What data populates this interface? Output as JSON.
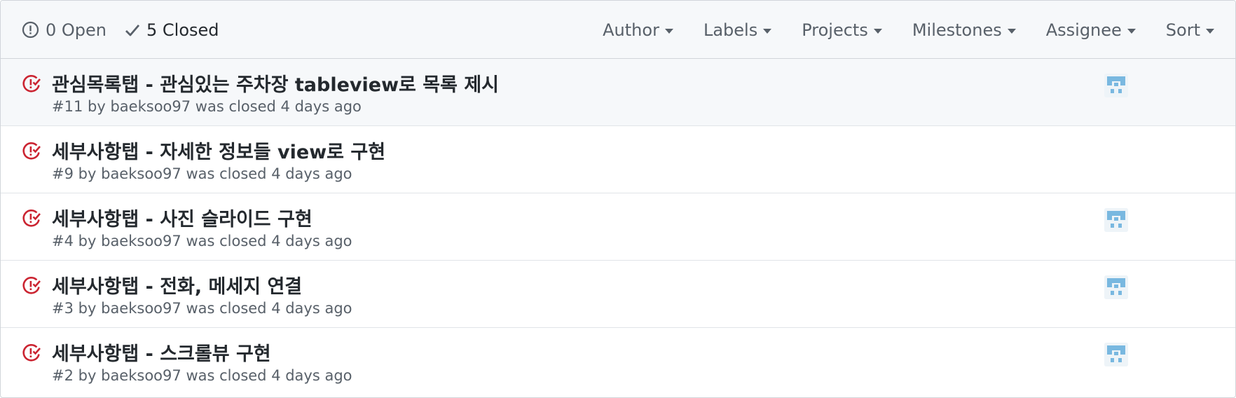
{
  "header": {
    "open": {
      "count_label": "0 Open",
      "icon": "issue-opened-icon"
    },
    "closed": {
      "count_label": "5 Closed",
      "icon": "check-icon"
    },
    "filters": [
      {
        "label": "Author"
      },
      {
        "label": "Labels"
      },
      {
        "label": "Projects"
      },
      {
        "label": "Milestones"
      },
      {
        "label": "Assignee"
      },
      {
        "label": "Sort"
      }
    ]
  },
  "issues": [
    {
      "title": "관심목록탭 - 관심있는 주차장 tableview로 목록 제시",
      "number": "#11",
      "by": "by",
      "author": "baeksoo97",
      "status": "was closed 4 days ago",
      "has_assignee": true
    },
    {
      "title": "세부사항탭 - 자세한 정보들 view로 구현",
      "number": "#9",
      "by": "by",
      "author": "baeksoo97",
      "status": "was closed 4 days ago",
      "has_assignee": false
    },
    {
      "title": "세부사항탭 - 사진 슬라이드 구현",
      "number": "#4",
      "by": "by",
      "author": "baeksoo97",
      "status": "was closed 4 days ago",
      "has_assignee": true
    },
    {
      "title": "세부사항탭 - 전화, 메세지 연결",
      "number": "#3",
      "by": "by",
      "author": "baeksoo97",
      "status": "was closed 4 days ago",
      "has_assignee": true
    },
    {
      "title": "세부사항탭 - 스크롤뷰 구현",
      "number": "#2",
      "by": "by",
      "author": "baeksoo97",
      "status": "was closed 4 days ago",
      "has_assignee": true
    }
  ],
  "colors": {
    "closed_icon": "#cb2431",
    "avatar": "#79b8e0",
    "header_bg": "#f6f8fa",
    "muted_text": "#586069"
  }
}
